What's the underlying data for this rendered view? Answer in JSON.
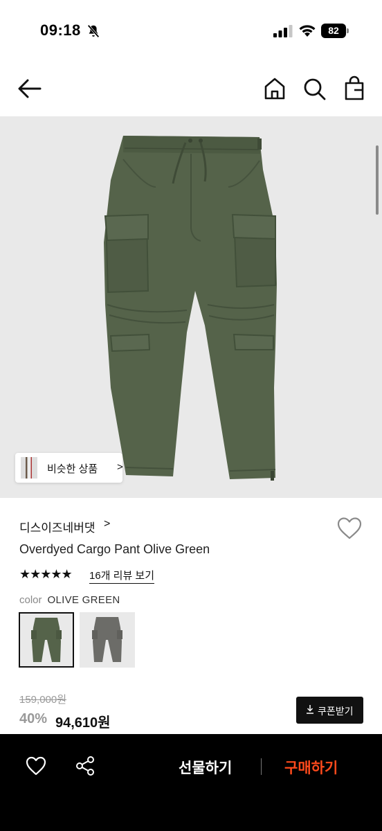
{
  "status_bar": {
    "time": "09:18",
    "battery": "82",
    "icons": [
      "bell-off-icon",
      "cellular-signal-icon",
      "wifi-icon",
      "battery-icon"
    ]
  },
  "header": {
    "icons": [
      "arrow-left-icon",
      "home-icon",
      "search-icon",
      "shopping-bag-icon"
    ]
  },
  "gallery": {
    "similar_label": "비슷한 상품",
    "similar_arrow": ">"
  },
  "product": {
    "brand": "디스이즈네버댓",
    "brand_chevron": ">",
    "name": "Overdyed Cargo Pant Olive Green",
    "stars": "★★★★★",
    "review_link": "16개 리뷰 보기",
    "color_label": "color",
    "color_value": "OLIVE GREEN",
    "swatches": [
      {
        "selected": true,
        "color": "#4f5d44"
      },
      {
        "selected": false,
        "color": "#6a6a66"
      }
    ]
  },
  "price": {
    "original": "159,000원",
    "discount": "40%",
    "sale": "94,610원",
    "coupon_label": "쿠폰받기"
  },
  "bottom_bar": {
    "gift_label": "선물하기",
    "buy_label": "구매하기",
    "buy_color": "#ff4a1c"
  },
  "colors": {
    "olive": "#55634a",
    "grey_pant": "#6c6c68",
    "image_bg": "#e9e9e9"
  }
}
